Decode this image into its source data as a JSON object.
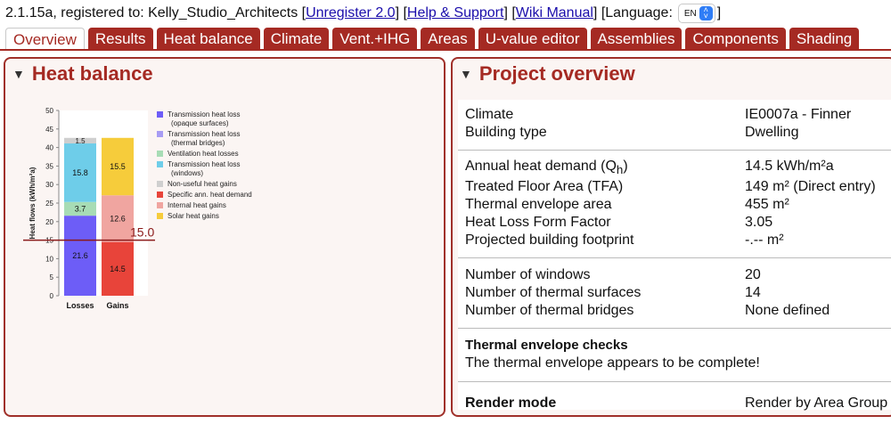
{
  "topbar": {
    "prefix": "2.1.15a, registered to: Kelly_Studio_Architects [",
    "unregister": "Unregister 2.0",
    "sep1": "] [",
    "help": "Help & Support",
    "sep2": "] [",
    "wiki": "Wiki Manual",
    "language_label": "] [Language:",
    "language_value": "EN",
    "close": "]"
  },
  "tabs": [
    "Overview",
    "Results",
    "Heat balance",
    "Climate",
    "Vent.+IHG",
    "Areas",
    "U-value editor",
    "Assemblies",
    "Components",
    "Shading"
  ],
  "heat_balance": {
    "title": "Heat balance",
    "legend": [
      {
        "label": "Transmission heat loss",
        "sub": "(opaque surfaces)",
        "color": "#6d5df7"
      },
      {
        "label": "Transmission heat loss",
        "sub": "(thermal bridges)",
        "color": "#a79cf3"
      },
      {
        "label": "Ventilation heat losses",
        "sub": "",
        "color": "#a7dcb5"
      },
      {
        "label": "Transmission heat loss",
        "sub": "(windows)",
        "color": "#6ecde9"
      },
      {
        "label": "Non-useful heat gains",
        "sub": "",
        "color": "#cfcfcf"
      },
      {
        "label": "Specific ann. heat demand",
        "sub": "",
        "color": "#e8443a"
      },
      {
        "label": "Internal heat gains",
        "sub": "",
        "color": "#f0a5a0"
      },
      {
        "label": "Solar heat gains",
        "sub": "",
        "color": "#f6cc3b"
      }
    ]
  },
  "chart_data": {
    "type": "bar",
    "stacked": true,
    "categories": [
      "Losses",
      "Gains"
    ],
    "ylabel": "Heat flows (kWh/m²a)",
    "ylim": [
      0,
      50
    ],
    "yticks": [
      0,
      5,
      10,
      15,
      20,
      25,
      30,
      35,
      40,
      45,
      50
    ],
    "reference_line": {
      "value": 15.0,
      "label": "15.0",
      "color": "#8b1a1a"
    },
    "series": [
      {
        "category": "Losses",
        "segments": [
          {
            "label": "21.6",
            "value": 21.6,
            "color": "#6d5df7"
          },
          {
            "label": "3.7",
            "value": 3.7,
            "color": "#a7dcb5"
          },
          {
            "label": "15.8",
            "value": 15.8,
            "color": "#6ecde9"
          },
          {
            "label": "1.5",
            "value": 1.5,
            "color": "#cfcfcf"
          }
        ]
      },
      {
        "category": "Gains",
        "segments": [
          {
            "label": "14.5",
            "value": 14.5,
            "color": "#e8443a"
          },
          {
            "label": "12.6",
            "value": 12.6,
            "color": "#f0a5a0"
          },
          {
            "label": "15.5",
            "value": 15.5,
            "color": "#f6cc3b"
          }
        ]
      }
    ]
  },
  "overview": {
    "title": "Project overview",
    "group1": [
      {
        "label": "Climate",
        "value": "IE0007a - Finner"
      },
      {
        "label": "Building type",
        "value": "Dwelling"
      }
    ],
    "annual_heat_demand": {
      "label_pre": "Annual heat demand (Q",
      "label_sub": "h",
      "label_post": ")",
      "value": "14.5 kWh/m²a"
    },
    "group2": [
      {
        "label": "Treated Floor Area (TFA)",
        "value": "149 m² (Direct entry)"
      },
      {
        "label": "Thermal envelope area",
        "value": "455 m²"
      },
      {
        "label": "Heat Loss Form Factor",
        "value": "3.05"
      },
      {
        "label": "Projected building footprint",
        "value": "-.-- m²"
      }
    ],
    "group3": [
      {
        "label": "Number of windows",
        "value": "20"
      },
      {
        "label": "Number of thermal surfaces",
        "value": "14"
      },
      {
        "label": "Number of thermal bridges",
        "value": "None defined"
      }
    ],
    "checks_title": "Thermal envelope checks",
    "checks_text": "The thermal envelope appears to be complete!",
    "render_mode_label": "Render mode",
    "render_mode_value": "Render by Area Group"
  }
}
